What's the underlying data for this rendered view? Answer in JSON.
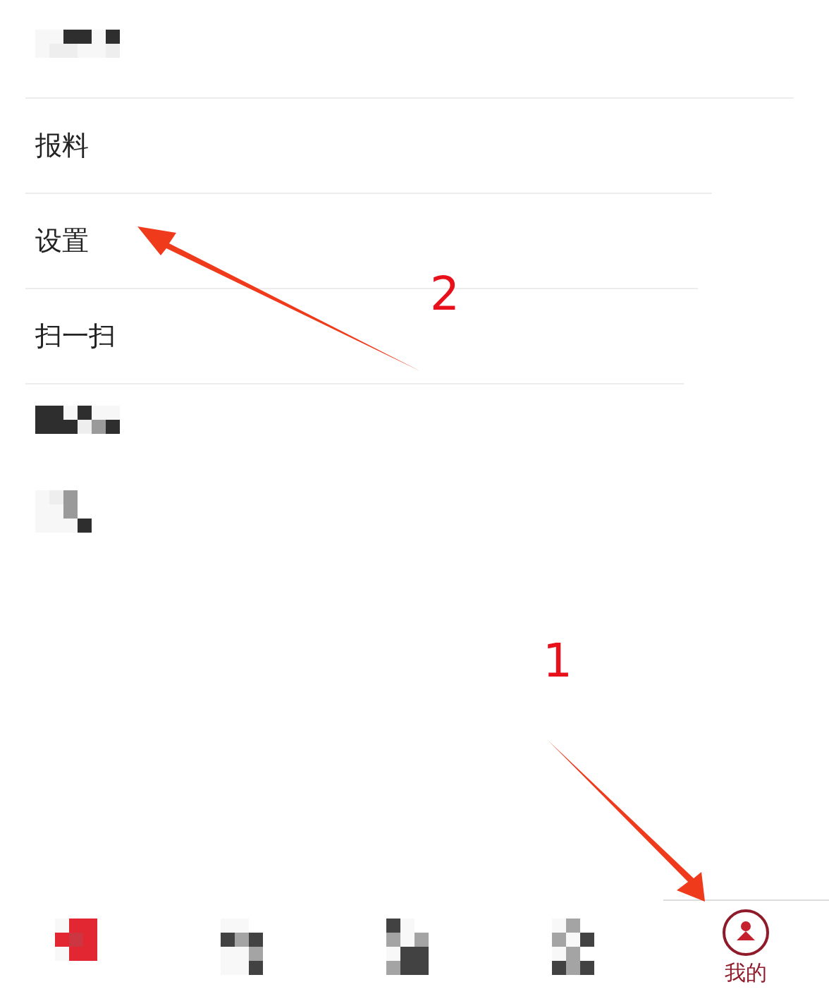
{
  "menu": [
    {
      "kind": "mosaic"
    },
    {
      "kind": "text",
      "label": "报料"
    },
    {
      "kind": "text",
      "label": "设置"
    },
    {
      "kind": "text",
      "label": "扫一扫"
    },
    {
      "kind": "mosaic"
    },
    {
      "kind": "mosaic"
    }
  ],
  "tab_bar": [
    {
      "kind": "mosaic",
      "selected": false
    },
    {
      "kind": "mosaic",
      "selected": false
    },
    {
      "kind": "mosaic",
      "selected": false
    },
    {
      "kind": "mosaic",
      "selected": false
    },
    {
      "kind": "text",
      "label": "我的",
      "selected": true
    }
  ],
  "annotations": [
    {
      "label": "2"
    },
    {
      "label": "1"
    }
  ]
}
